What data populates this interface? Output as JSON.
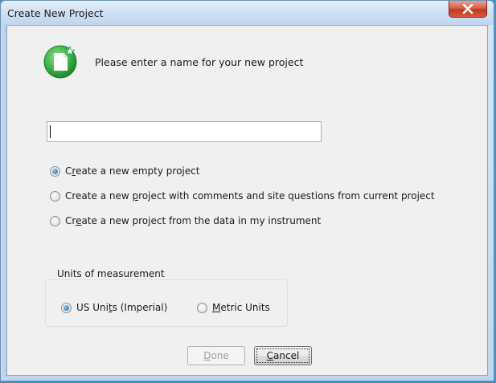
{
  "window": {
    "title": "Create New Project",
    "close_label": "x"
  },
  "header": {
    "text": "Please enter a name for your new project",
    "icon": "new-project-icon"
  },
  "name_input": {
    "value": "",
    "placeholder": ""
  },
  "project_options": [
    {
      "pre": "C",
      "mn": "r",
      "post": "eate a new empty project",
      "selected": true
    },
    {
      "pre": "Create a new ",
      "mn": "p",
      "post": "roject with comments and site questions from current project",
      "selected": false
    },
    {
      "pre": "Cr",
      "mn": "e",
      "post": "ate a new project from the data in my instrument",
      "selected": false
    }
  ],
  "units": {
    "legend": "Units of measurement",
    "options": [
      {
        "pre": "US Uni",
        "mn": "t",
        "post": "s (Imperial)",
        "selected": true
      },
      {
        "pre": "",
        "mn": "M",
        "post": "etric Units",
        "selected": false
      }
    ]
  },
  "buttons": {
    "done": {
      "mn": "D",
      "post": "one",
      "enabled": false
    },
    "cancel": {
      "mn": "C",
      "post": "ancel",
      "enabled": true
    }
  },
  "colors": {
    "accent_green": "#3cb54a",
    "close_red": "#c3381f"
  }
}
